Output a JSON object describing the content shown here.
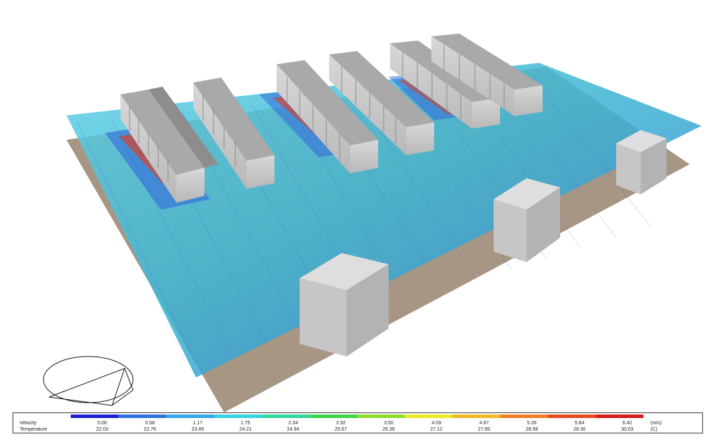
{
  "legend": {
    "velocity_label": "Velocity",
    "temperature_label": "Temperature",
    "velocity_unit": "(m/s)",
    "temperature_unit": "(C)",
    "velocity_values": [
      "0.00",
      "0.58",
      "1.17",
      "1.75",
      "2.34",
      "2.92",
      "3.50",
      "4.09",
      "4.67",
      "5.26",
      "5.84",
      "6.42"
    ],
    "temperature_values": [
      "22.03",
      "22.76",
      "23.49",
      "24.21",
      "24.94",
      "25.67",
      "26.39",
      "27.12",
      "27.85",
      "28.58",
      "29.30",
      "30.03"
    ],
    "colors": [
      "#1f1fd6",
      "#2f72df",
      "#33a8e8",
      "#34d3e2",
      "#2fd89a",
      "#3bd84a",
      "#8ede2c",
      "#e9ea24",
      "#f0b822",
      "#ef7f20",
      "#e64b1e",
      "#d81c1c"
    ]
  },
  "scene": {
    "floor_color": "#a89684",
    "flow_plane_color": "#3aa8d8",
    "rack_color": "#c9c9c9",
    "column_color": "#d2d2d2",
    "rack_rows": 6,
    "columns": 3
  },
  "orientation_triad": {
    "icon": "orientation-axis-icon"
  }
}
